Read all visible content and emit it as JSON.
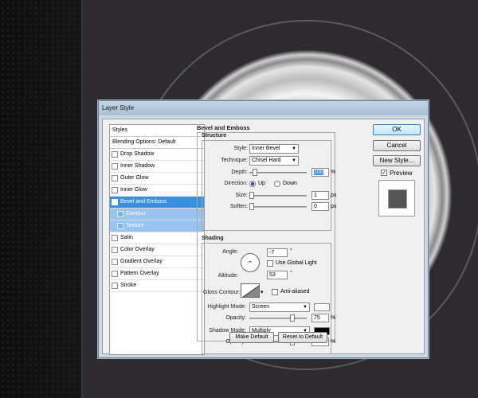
{
  "window": {
    "title": "Layer Style"
  },
  "styles_list": {
    "header": "Styles",
    "blending_options": "Blending Options: Default",
    "items": [
      {
        "label": "Drop Shadow",
        "checked": false,
        "state": "normal"
      },
      {
        "label": "Inner Shadow",
        "checked": false,
        "state": "normal"
      },
      {
        "label": "Outer Glow",
        "checked": false,
        "state": "normal"
      },
      {
        "label": "Inner Glow",
        "checked": false,
        "state": "normal"
      },
      {
        "label": "Bevel and Emboss",
        "checked": true,
        "state": "selected"
      },
      {
        "label": "Contour",
        "checked": false,
        "state": "sub"
      },
      {
        "label": "Texture",
        "checked": false,
        "state": "sub"
      },
      {
        "label": "Satin",
        "checked": false,
        "state": "normal"
      },
      {
        "label": "Color Overlay",
        "checked": false,
        "state": "normal"
      },
      {
        "label": "Gradient Overlay",
        "checked": false,
        "state": "normal"
      },
      {
        "label": "Pattern Overlay",
        "checked": false,
        "state": "normal"
      },
      {
        "label": "Stroke",
        "checked": false,
        "state": "normal"
      }
    ]
  },
  "bevel": {
    "title": "Bevel and Emboss",
    "structure": {
      "title": "Structure",
      "style_label": "Style:",
      "style_value": "Inner Bevel",
      "technique_label": "Technique:",
      "technique_value": "Chisel Hard",
      "depth_label": "Depth:",
      "depth_value": "100",
      "depth_unit": "%",
      "direction_label": "Direction:",
      "direction_up": "Up",
      "direction_down": "Down",
      "direction_selected": "Up",
      "size_label": "Size:",
      "size_value": "1",
      "size_unit": "px",
      "soften_label": "Soften:",
      "soften_value": "0",
      "soften_unit": "px"
    },
    "shading": {
      "title": "Shading",
      "angle_label": "Angle:",
      "angle_value": "-7",
      "angle_unit": "°",
      "use_global_light_label": "Use Global Light",
      "use_global_light": false,
      "altitude_label": "Altitude:",
      "altitude_value": "53",
      "altitude_unit": "°",
      "gloss_contour_label": "Gloss Contour:",
      "anti_aliased_label": "Anti-aliased",
      "anti_aliased": false,
      "highlight_mode_label": "Highlight Mode:",
      "highlight_mode_value": "Screen",
      "highlight_color": "#ffffff",
      "highlight_opacity_label": "Opacity:",
      "highlight_opacity_value": "75",
      "highlight_opacity_unit": "%",
      "shadow_mode_label": "Shadow Mode:",
      "shadow_mode_value": "Multiply",
      "shadow_color": "#000000",
      "shadow_opacity_label": "Opacity:",
      "shadow_opacity_value": "75",
      "shadow_opacity_unit": "%"
    },
    "make_default": "Make Default",
    "reset_to_default": "Reset to Default"
  },
  "actions": {
    "ok": "OK",
    "cancel": "Cancel",
    "new_style": "New Style...",
    "preview_label": "Preview",
    "preview_checked": true
  }
}
